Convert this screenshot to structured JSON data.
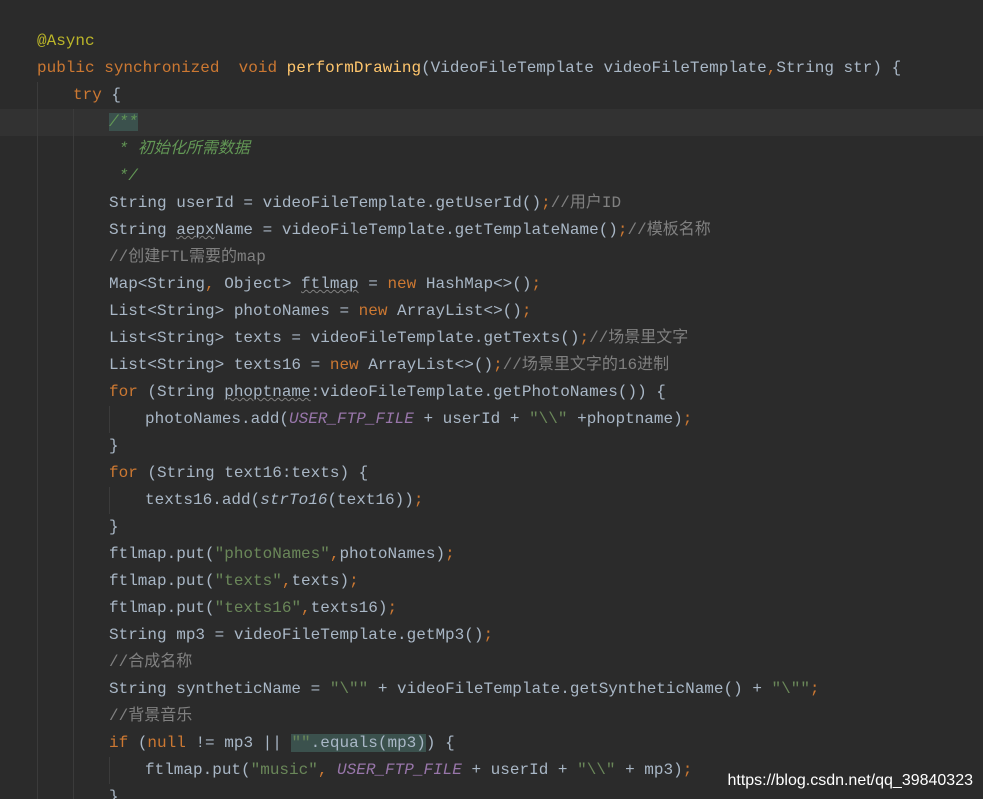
{
  "colors": {
    "background": "#2b2b2b",
    "current_line": "#323232",
    "keyword": "#cc7832",
    "function": "#ffc66d",
    "string": "#6a8759",
    "constant": "#9876aa",
    "comment": "#808080",
    "doc_comment": "#629755",
    "annotation": "#bbb529",
    "plain": "#a9b7c6"
  },
  "lines": [
    {
      "indent": 0,
      "tokens": [
        {
          "t": "@Async",
          "k": "ann"
        }
      ]
    },
    {
      "indent": 0,
      "tokens": [
        {
          "t": "public ",
          "k": "kw"
        },
        {
          "t": "synchronized  ",
          "k": "kw"
        },
        {
          "t": "void ",
          "k": "kw"
        },
        {
          "t": "performDrawing",
          "k": "fn"
        },
        {
          "t": "(VideoFileTemplate videoFileTemplate",
          "k": "plain"
        },
        {
          "t": ",",
          "k": "punc"
        },
        {
          "t": "String str) {",
          "k": "plain"
        }
      ]
    },
    {
      "indent": 1,
      "tokens": [
        {
          "t": "try ",
          "k": "kw"
        },
        {
          "t": "{",
          "k": "plain"
        }
      ]
    },
    {
      "indent": 2,
      "current": true,
      "tokens": [
        {
          "t": "/**",
          "k": "doc",
          "hl": "doc"
        }
      ]
    },
    {
      "indent": 2,
      "tokens": [
        {
          "t": " * 初始化所需数据",
          "k": "doc"
        }
      ]
    },
    {
      "indent": 2,
      "tokens": [
        {
          "t": " */",
          "k": "doc"
        }
      ]
    },
    {
      "indent": 2,
      "tokens": [
        {
          "t": "String userId = videoFileTemplate.getUserId()",
          "k": "plain"
        },
        {
          "t": ";",
          "k": "punc"
        },
        {
          "t": "//用户ID",
          "k": "cmt"
        }
      ]
    },
    {
      "indent": 2,
      "tokens": [
        {
          "t": "String ",
          "k": "plain"
        },
        {
          "t": "aepx",
          "k": "plain",
          "warn": true
        },
        {
          "t": "Name = videoFileTemplate.getTemplateName()",
          "k": "plain"
        },
        {
          "t": ";",
          "k": "punc"
        },
        {
          "t": "//模板名称",
          "k": "cmt"
        }
      ]
    },
    {
      "indent": 2,
      "tokens": [
        {
          "t": "//创建FTL需要的map",
          "k": "cmt"
        }
      ]
    },
    {
      "indent": 2,
      "tokens": [
        {
          "t": "Map<String",
          "k": "plain"
        },
        {
          "t": ", ",
          "k": "punc"
        },
        {
          "t": "Object> ",
          "k": "plain"
        },
        {
          "t": "ftlmap",
          "k": "plain",
          "warn": true
        },
        {
          "t": " = ",
          "k": "plain"
        },
        {
          "t": "new ",
          "k": "kw"
        },
        {
          "t": "HashMap<>()",
          "k": "plain"
        },
        {
          "t": ";",
          "k": "punc"
        }
      ]
    },
    {
      "indent": 2,
      "tokens": [
        {
          "t": "List<String> photoNames = ",
          "k": "plain"
        },
        {
          "t": "new ",
          "k": "kw"
        },
        {
          "t": "ArrayList<>()",
          "k": "plain"
        },
        {
          "t": ";",
          "k": "punc"
        }
      ]
    },
    {
      "indent": 2,
      "tokens": [
        {
          "t": "List<String> texts = videoFileTemplate.getTexts()",
          "k": "plain"
        },
        {
          "t": ";",
          "k": "punc"
        },
        {
          "t": "//场景里文字",
          "k": "cmt"
        }
      ]
    },
    {
      "indent": 2,
      "tokens": [
        {
          "t": "List<String> texts16 = ",
          "k": "plain"
        },
        {
          "t": "new ",
          "k": "kw"
        },
        {
          "t": "ArrayList<>()",
          "k": "plain"
        },
        {
          "t": ";",
          "k": "punc"
        },
        {
          "t": "//场景里文字的16进制",
          "k": "cmt"
        }
      ]
    },
    {
      "indent": 2,
      "tokens": [
        {
          "t": "for ",
          "k": "kw"
        },
        {
          "t": "(String ",
          "k": "plain"
        },
        {
          "t": "phoptname",
          "k": "plain",
          "warn": true
        },
        {
          "t": ":videoFileTemplate.getPhotoNames()) {",
          "k": "plain"
        }
      ]
    },
    {
      "indent": 3,
      "tokens": [
        {
          "t": "photoNames.add(",
          "k": "plain"
        },
        {
          "t": "USER_FTP_FILE",
          "k": "const"
        },
        {
          "t": " + userId + ",
          "k": "plain"
        },
        {
          "t": "\"\\\\\"",
          "k": "str"
        },
        {
          "t": " +phoptname)",
          "k": "plain"
        },
        {
          "t": ";",
          "k": "punc"
        }
      ]
    },
    {
      "indent": 2,
      "tokens": [
        {
          "t": "}",
          "k": "plain"
        }
      ]
    },
    {
      "indent": 2,
      "tokens": [
        {
          "t": "for ",
          "k": "kw"
        },
        {
          "t": "(String text16:texts) {",
          "k": "plain"
        }
      ]
    },
    {
      "indent": 3,
      "tokens": [
        {
          "t": "texts16.add(",
          "k": "plain"
        },
        {
          "t": "strTo16",
          "k": "ital"
        },
        {
          "t": "(text16))",
          "k": "plain"
        },
        {
          "t": ";",
          "k": "punc"
        }
      ]
    },
    {
      "indent": 2,
      "tokens": [
        {
          "t": "}",
          "k": "plain"
        }
      ]
    },
    {
      "indent": 2,
      "tokens": [
        {
          "t": "ftlmap.put(",
          "k": "plain"
        },
        {
          "t": "\"photoNames\"",
          "k": "str"
        },
        {
          "t": ",",
          "k": "punc"
        },
        {
          "t": "photoNames)",
          "k": "plain"
        },
        {
          "t": ";",
          "k": "punc"
        }
      ]
    },
    {
      "indent": 2,
      "tokens": [
        {
          "t": "ftlmap.put(",
          "k": "plain"
        },
        {
          "t": "\"texts\"",
          "k": "str"
        },
        {
          "t": ",",
          "k": "punc"
        },
        {
          "t": "texts)",
          "k": "plain"
        },
        {
          "t": ";",
          "k": "punc"
        }
      ]
    },
    {
      "indent": 2,
      "tokens": [
        {
          "t": "ftlmap.put(",
          "k": "plain"
        },
        {
          "t": "\"texts16\"",
          "k": "str"
        },
        {
          "t": ",",
          "k": "punc"
        },
        {
          "t": "texts16)",
          "k": "plain"
        },
        {
          "t": ";",
          "k": "punc"
        }
      ]
    },
    {
      "indent": 2,
      "tokens": [
        {
          "t": "String mp3 = videoFileTemplate.getMp3()",
          "k": "plain"
        },
        {
          "t": ";",
          "k": "punc"
        }
      ]
    },
    {
      "indent": 2,
      "tokens": [
        {
          "t": "//合成名称",
          "k": "cmt"
        }
      ]
    },
    {
      "indent": 2,
      "tokens": [
        {
          "t": "String syntheticName = ",
          "k": "plain"
        },
        {
          "t": "\"\\\"\"",
          "k": "str"
        },
        {
          "t": " + videoFileTemplate.getSyntheticName() + ",
          "k": "plain"
        },
        {
          "t": "\"\\\"\"",
          "k": "str"
        },
        {
          "t": ";",
          "k": "punc"
        }
      ]
    },
    {
      "indent": 2,
      "tokens": [
        {
          "t": "//背景音乐",
          "k": "cmt"
        }
      ]
    },
    {
      "indent": 2,
      "tokens": [
        {
          "t": "if ",
          "k": "kw"
        },
        {
          "t": "(",
          "k": "plain"
        },
        {
          "t": "null ",
          "k": "kw"
        },
        {
          "t": "!= mp3 || ",
          "k": "plain"
        },
        {
          "t": "\"\"",
          "k": "str",
          "hl": "box"
        },
        {
          "t": ".equals(mp3)",
          "k": "plain",
          "hl": "box"
        },
        {
          "t": ") {",
          "k": "plain"
        }
      ]
    },
    {
      "indent": 3,
      "tokens": [
        {
          "t": "ftlmap.put(",
          "k": "plain"
        },
        {
          "t": "\"music\"",
          "k": "str"
        },
        {
          "t": ", ",
          "k": "punc"
        },
        {
          "t": "USER_FTP_FILE",
          "k": "const"
        },
        {
          "t": " + userId + ",
          "k": "plain"
        },
        {
          "t": "\"\\\\\"",
          "k": "str"
        },
        {
          "t": " + mp3)",
          "k": "plain"
        },
        {
          "t": ";",
          "k": "punc"
        }
      ]
    },
    {
      "indent": 2,
      "tokens": [
        {
          "t": "}",
          "k": "plain"
        }
      ]
    }
  ],
  "watermark": "https://blog.csdn.net/qq_39840323"
}
